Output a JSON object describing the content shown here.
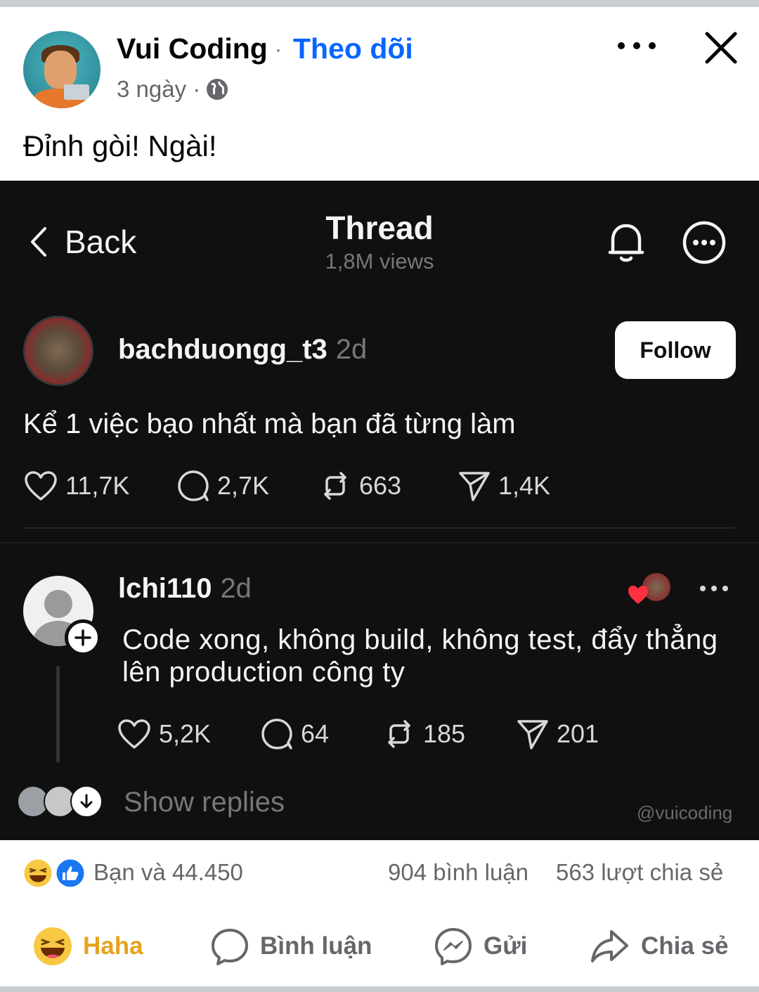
{
  "post": {
    "author": "Vui Coding",
    "separator": "·",
    "follow_label": "Theo dõi",
    "time": "3 ngày ·",
    "caption": "Đỉnh gòi! Ngài!"
  },
  "thread": {
    "back_label": "Back",
    "title": "Thread",
    "views": "1,8M views",
    "post": {
      "username": "bachduongg_t3",
      "time": "2d",
      "follow_label": "Follow",
      "text": "Kể 1 việc bạo nhất mà bạn đã từng làm",
      "likes": "11,7K",
      "comments": "2,7K",
      "reposts": "663",
      "shares": "1,4K"
    },
    "reply": {
      "username": "lchi110",
      "time": "2d",
      "text": "Code xong, không build, không test, đẩy thẳng lên production công ty",
      "likes": "5,2K",
      "comments": "64",
      "reposts": "185",
      "shares": "201"
    },
    "show_replies_label": "Show replies",
    "watermark": "@vuicoding"
  },
  "footer": {
    "reaction_summary": "Bạn và 44.450",
    "comment_count": "904 bình luận",
    "share_count": "563 lượt chia sẻ",
    "actions": {
      "react": "Haha",
      "comment": "Bình luận",
      "send": "Gửi",
      "share": "Chia sẻ"
    }
  },
  "colors": {
    "fb_blue": "#0866ff",
    "thread_bg": "#101010",
    "muted": "#65676b",
    "haha": "#e5a31d"
  },
  "icons": [
    "globe-icon",
    "more-icon",
    "close-icon",
    "chevron-left-icon",
    "bell-icon",
    "more-circle-icon",
    "heart-icon",
    "comment-icon",
    "repost-icon",
    "send-icon",
    "plus-icon",
    "haha-icon",
    "like-icon",
    "messenger-icon",
    "share-icon"
  ]
}
